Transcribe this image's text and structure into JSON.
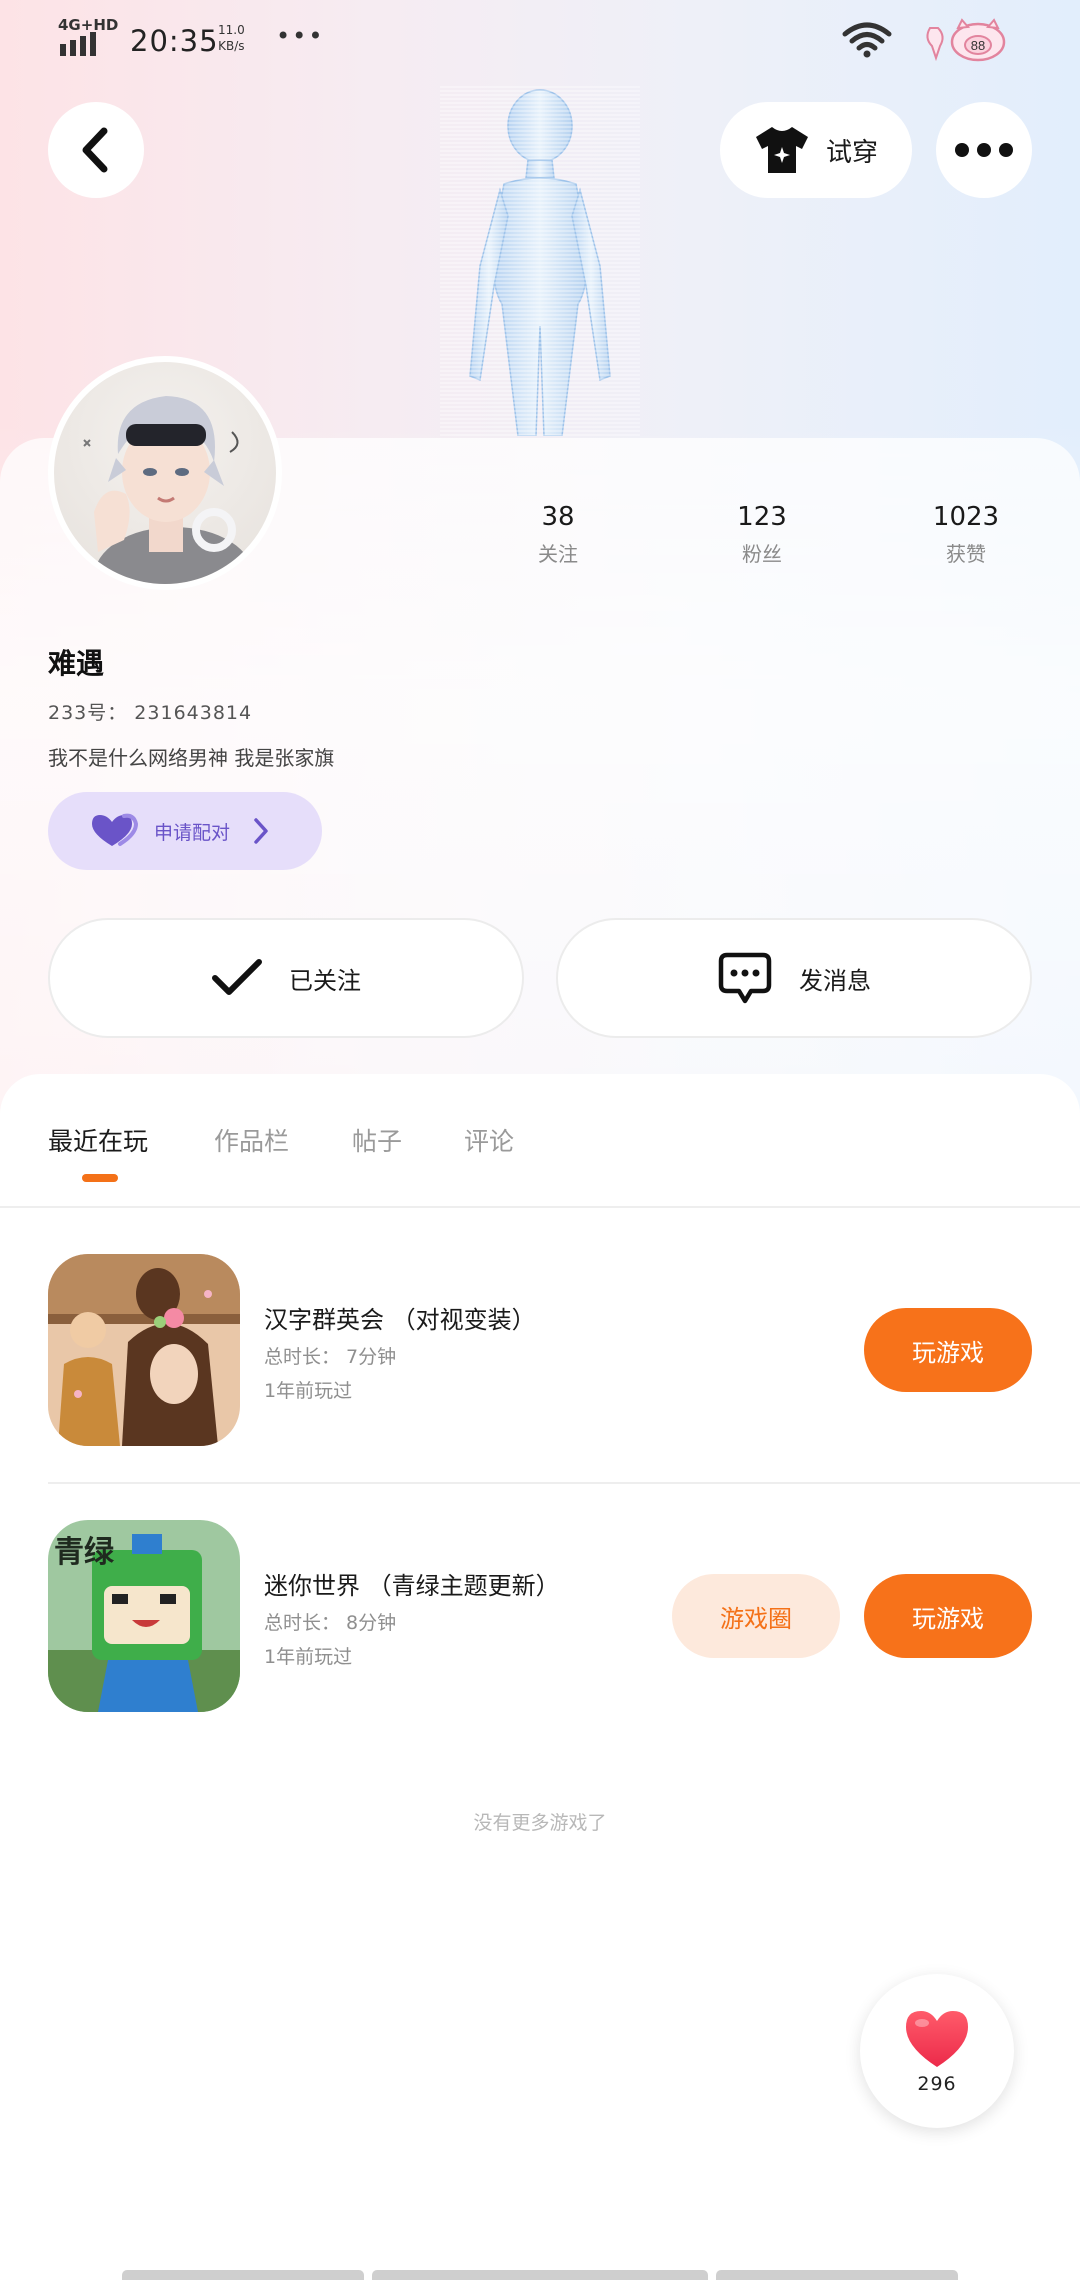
{
  "status_bar": {
    "network": "4G+HD",
    "time": "20:35",
    "speed_value": "11.0",
    "speed_unit": "KB/s",
    "overflow": "•••",
    "battery_badge": "88"
  },
  "header": {
    "try_on_label": "试穿"
  },
  "profile": {
    "nickname": "难遇",
    "id_line": "233号： 231643814",
    "bio": "我不是什么网络男神  我是张家旗",
    "stats": [
      {
        "value": "38",
        "label": "关注"
      },
      {
        "value": "123",
        "label": "粉丝"
      },
      {
        "value": "1023",
        "label": "获赞"
      }
    ],
    "pair_label": "申请配对"
  },
  "actions": {
    "follow_label": "已关注",
    "message_label": "发消息"
  },
  "tabs": [
    {
      "label": "最近在玩"
    },
    {
      "label": "作品栏"
    },
    {
      "label": "帖子"
    },
    {
      "label": "评论"
    }
  ],
  "games": [
    {
      "title": "汉字群英会 （对视变装）",
      "duration": "总时长：  7分钟",
      "last_played": "1年前玩过",
      "play_label": "玩游戏"
    },
    {
      "title": "迷你世界 （青绿主题更新）",
      "duration": "总时长：  8分钟",
      "last_played": "1年前玩过",
      "circle_label": "游戏圈",
      "play_label": "玩游戏",
      "icon_text": "青绿"
    }
  ],
  "no_more_text": "没有更多游戏了",
  "like": {
    "count": "296"
  },
  "colors": {
    "accent": "#f7721a",
    "pair_bg": "#e6defa",
    "pair_text": "#6a54c8"
  }
}
